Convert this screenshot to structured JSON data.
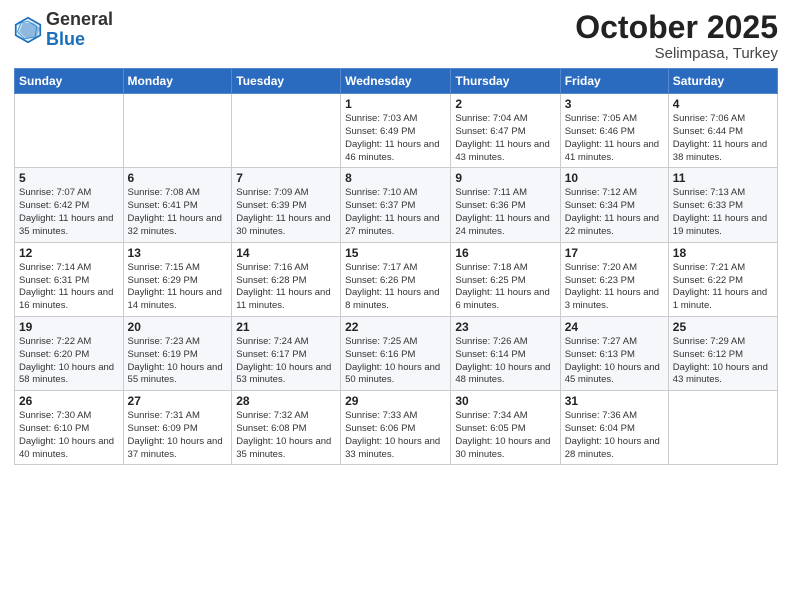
{
  "header": {
    "logo_general": "General",
    "logo_blue": "Blue",
    "month_title": "October 2025",
    "location": "Selimpasa, Turkey"
  },
  "weekdays": [
    "Sunday",
    "Monday",
    "Tuesday",
    "Wednesday",
    "Thursday",
    "Friday",
    "Saturday"
  ],
  "weeks": [
    [
      {
        "day": "",
        "info": ""
      },
      {
        "day": "",
        "info": ""
      },
      {
        "day": "",
        "info": ""
      },
      {
        "day": "1",
        "info": "Sunrise: 7:03 AM\nSunset: 6:49 PM\nDaylight: 11 hours and 46 minutes."
      },
      {
        "day": "2",
        "info": "Sunrise: 7:04 AM\nSunset: 6:47 PM\nDaylight: 11 hours and 43 minutes."
      },
      {
        "day": "3",
        "info": "Sunrise: 7:05 AM\nSunset: 6:46 PM\nDaylight: 11 hours and 41 minutes."
      },
      {
        "day": "4",
        "info": "Sunrise: 7:06 AM\nSunset: 6:44 PM\nDaylight: 11 hours and 38 minutes."
      }
    ],
    [
      {
        "day": "5",
        "info": "Sunrise: 7:07 AM\nSunset: 6:42 PM\nDaylight: 11 hours and 35 minutes."
      },
      {
        "day": "6",
        "info": "Sunrise: 7:08 AM\nSunset: 6:41 PM\nDaylight: 11 hours and 32 minutes."
      },
      {
        "day": "7",
        "info": "Sunrise: 7:09 AM\nSunset: 6:39 PM\nDaylight: 11 hours and 30 minutes."
      },
      {
        "day": "8",
        "info": "Sunrise: 7:10 AM\nSunset: 6:37 PM\nDaylight: 11 hours and 27 minutes."
      },
      {
        "day": "9",
        "info": "Sunrise: 7:11 AM\nSunset: 6:36 PM\nDaylight: 11 hours and 24 minutes."
      },
      {
        "day": "10",
        "info": "Sunrise: 7:12 AM\nSunset: 6:34 PM\nDaylight: 11 hours and 22 minutes."
      },
      {
        "day": "11",
        "info": "Sunrise: 7:13 AM\nSunset: 6:33 PM\nDaylight: 11 hours and 19 minutes."
      }
    ],
    [
      {
        "day": "12",
        "info": "Sunrise: 7:14 AM\nSunset: 6:31 PM\nDaylight: 11 hours and 16 minutes."
      },
      {
        "day": "13",
        "info": "Sunrise: 7:15 AM\nSunset: 6:29 PM\nDaylight: 11 hours and 14 minutes."
      },
      {
        "day": "14",
        "info": "Sunrise: 7:16 AM\nSunset: 6:28 PM\nDaylight: 11 hours and 11 minutes."
      },
      {
        "day": "15",
        "info": "Sunrise: 7:17 AM\nSunset: 6:26 PM\nDaylight: 11 hours and 8 minutes."
      },
      {
        "day": "16",
        "info": "Sunrise: 7:18 AM\nSunset: 6:25 PM\nDaylight: 11 hours and 6 minutes."
      },
      {
        "day": "17",
        "info": "Sunrise: 7:20 AM\nSunset: 6:23 PM\nDaylight: 11 hours and 3 minutes."
      },
      {
        "day": "18",
        "info": "Sunrise: 7:21 AM\nSunset: 6:22 PM\nDaylight: 11 hours and 1 minute."
      }
    ],
    [
      {
        "day": "19",
        "info": "Sunrise: 7:22 AM\nSunset: 6:20 PM\nDaylight: 10 hours and 58 minutes."
      },
      {
        "day": "20",
        "info": "Sunrise: 7:23 AM\nSunset: 6:19 PM\nDaylight: 10 hours and 55 minutes."
      },
      {
        "day": "21",
        "info": "Sunrise: 7:24 AM\nSunset: 6:17 PM\nDaylight: 10 hours and 53 minutes."
      },
      {
        "day": "22",
        "info": "Sunrise: 7:25 AM\nSunset: 6:16 PM\nDaylight: 10 hours and 50 minutes."
      },
      {
        "day": "23",
        "info": "Sunrise: 7:26 AM\nSunset: 6:14 PM\nDaylight: 10 hours and 48 minutes."
      },
      {
        "day": "24",
        "info": "Sunrise: 7:27 AM\nSunset: 6:13 PM\nDaylight: 10 hours and 45 minutes."
      },
      {
        "day": "25",
        "info": "Sunrise: 7:29 AM\nSunset: 6:12 PM\nDaylight: 10 hours and 43 minutes."
      }
    ],
    [
      {
        "day": "26",
        "info": "Sunrise: 7:30 AM\nSunset: 6:10 PM\nDaylight: 10 hours and 40 minutes."
      },
      {
        "day": "27",
        "info": "Sunrise: 7:31 AM\nSunset: 6:09 PM\nDaylight: 10 hours and 37 minutes."
      },
      {
        "day": "28",
        "info": "Sunrise: 7:32 AM\nSunset: 6:08 PM\nDaylight: 10 hours and 35 minutes."
      },
      {
        "day": "29",
        "info": "Sunrise: 7:33 AM\nSunset: 6:06 PM\nDaylight: 10 hours and 33 minutes."
      },
      {
        "day": "30",
        "info": "Sunrise: 7:34 AM\nSunset: 6:05 PM\nDaylight: 10 hours and 30 minutes."
      },
      {
        "day": "31",
        "info": "Sunrise: 7:36 AM\nSunset: 6:04 PM\nDaylight: 10 hours and 28 minutes."
      },
      {
        "day": "",
        "info": ""
      }
    ]
  ]
}
